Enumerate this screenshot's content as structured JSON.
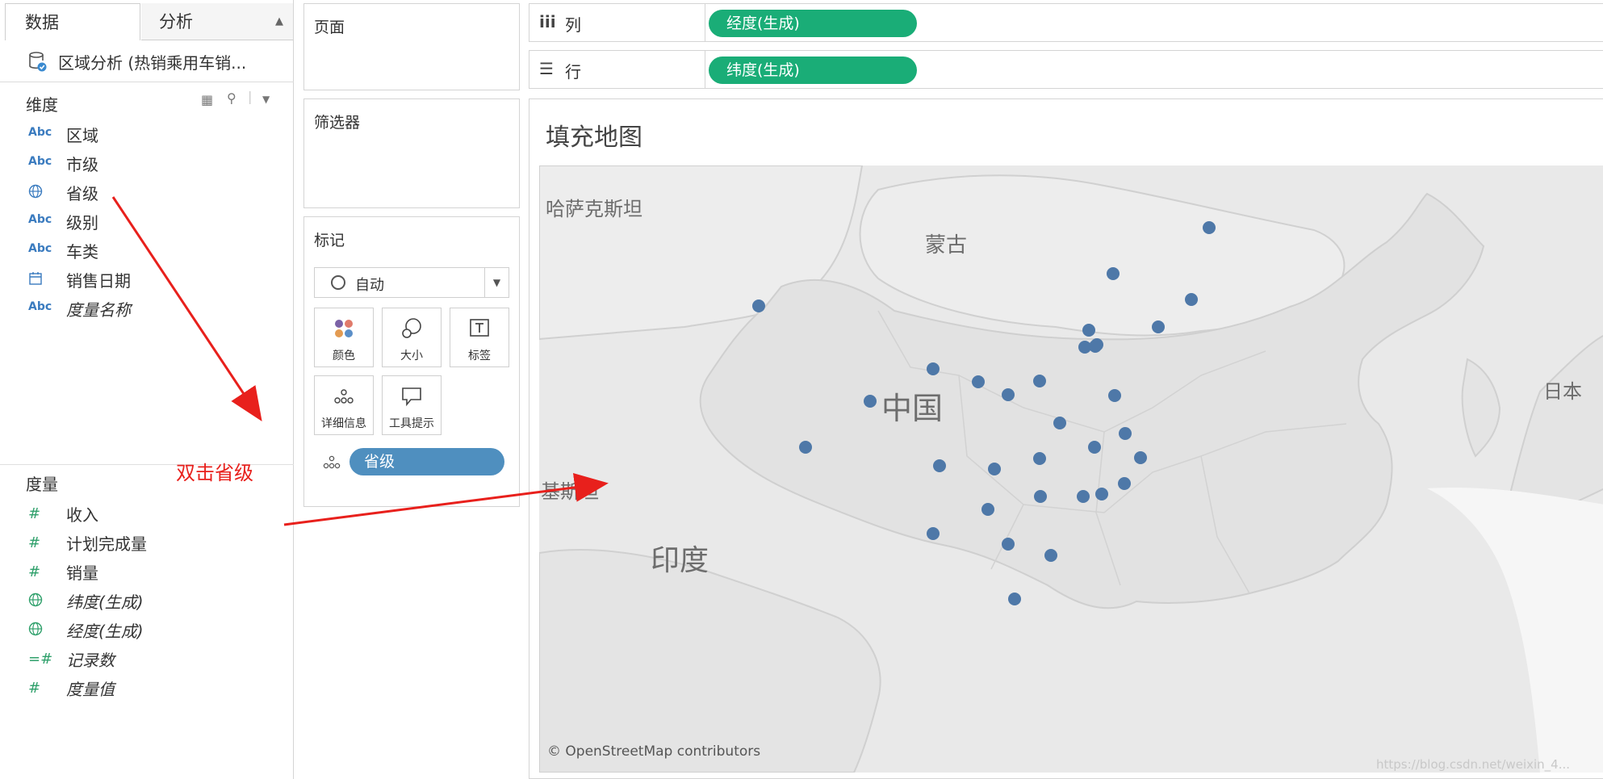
{
  "tabs": {
    "data": "数据",
    "analysis": "分析"
  },
  "datasource": {
    "name": "区域分析 (热销乘用车销..."
  },
  "dimensions": {
    "header": "维度",
    "fields": [
      {
        "type_label": "Abc",
        "name": "区域",
        "icon": "string-icon"
      },
      {
        "type_label": "Abc",
        "name": "市级",
        "icon": "string-icon"
      },
      {
        "type_label": "",
        "name": "省级",
        "icon": "globe-icon"
      },
      {
        "type_label": "Abc",
        "name": "级别",
        "icon": "string-icon"
      },
      {
        "type_label": "Abc",
        "name": "车类",
        "icon": "string-icon"
      },
      {
        "type_label": "",
        "name": "销售日期",
        "icon": "calendar-icon"
      },
      {
        "type_label": "Abc",
        "name": "度量名称",
        "icon": "string-icon"
      }
    ]
  },
  "measures": {
    "header": "度量",
    "fields": [
      {
        "type_label": "#",
        "name": "收入",
        "icon": "number-icon"
      },
      {
        "type_label": "#",
        "name": "计划完成量",
        "icon": "number-icon"
      },
      {
        "type_label": "#",
        "name": "销量",
        "icon": "number-icon"
      },
      {
        "type_label": "",
        "name": "纬度(生成)",
        "icon": "globe-icon"
      },
      {
        "type_label": "",
        "name": "经度(生成)",
        "icon": "globe-icon"
      },
      {
        "type_label": "=#",
        "name": "记录数",
        "icon": "calculated-number-icon"
      },
      {
        "type_label": "#",
        "name": "度量值",
        "icon": "number-icon"
      }
    ]
  },
  "annotation": {
    "text": "双击省级",
    "color": "#e8201c"
  },
  "cards": {
    "pages": "页面",
    "filters": "筛选器",
    "marks": "标记"
  },
  "marks": {
    "type": "自动",
    "buttons": {
      "color": "颜色",
      "size": "大小",
      "label": "标签",
      "detail": "详细信息",
      "tooltip": "工具提示"
    },
    "pill": "省级"
  },
  "shelves": {
    "columns": {
      "label": "列",
      "pill": "经度(生成)"
    },
    "rows": {
      "label": "行",
      "pill": "纬度(生成)"
    }
  },
  "view": {
    "title": "填充地图",
    "attribution": "© OpenStreetMap contributors",
    "map_labels": {
      "kazakhstan": "哈萨克斯坦",
      "mongolia": "蒙古",
      "china": "中国",
      "japan": "日本",
      "pakistan": "基斯坦",
      "india": "印度"
    }
  },
  "watermark": "https://blog.csdn.net/weixin_4...",
  "colors": {
    "pill_green": "#1aad77",
    "pill_blue": "#4f8fbf",
    "mark_blue": "#4e78a8",
    "annotation_red": "#e8201c"
  }
}
